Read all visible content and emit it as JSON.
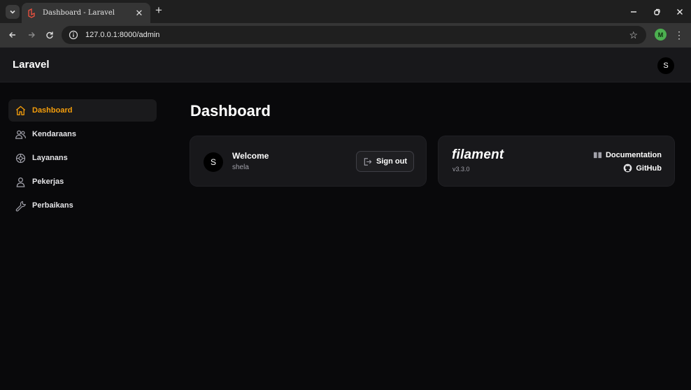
{
  "browser": {
    "tab_title": "Dashboard - Laravel",
    "url": "127.0.0.1:8000/admin",
    "profile_initial": "M"
  },
  "app": {
    "brand": "Laravel",
    "user_initial": "S"
  },
  "sidebar": {
    "items": [
      {
        "label": "Dashboard",
        "icon": "home-icon",
        "active": true
      },
      {
        "label": "Kendaraans",
        "icon": "users-icon",
        "active": false
      },
      {
        "label": "Layanans",
        "icon": "settings-icon",
        "active": false
      },
      {
        "label": "Pekerjas",
        "icon": "user-icon",
        "active": false
      },
      {
        "label": "Perbaikans",
        "icon": "wrench-icon",
        "active": false
      }
    ]
  },
  "main": {
    "title": "Dashboard",
    "welcome": {
      "avatar_initial": "S",
      "title": "Welcome",
      "username": "shela",
      "signout_label": "Sign out"
    },
    "filament": {
      "logo": "filament",
      "version": "v3.3.0",
      "docs_label": "Documentation",
      "github_label": "GitHub"
    }
  },
  "colors": {
    "accent": "#f59e0b",
    "background": "#09090b",
    "card": "#18181b"
  }
}
